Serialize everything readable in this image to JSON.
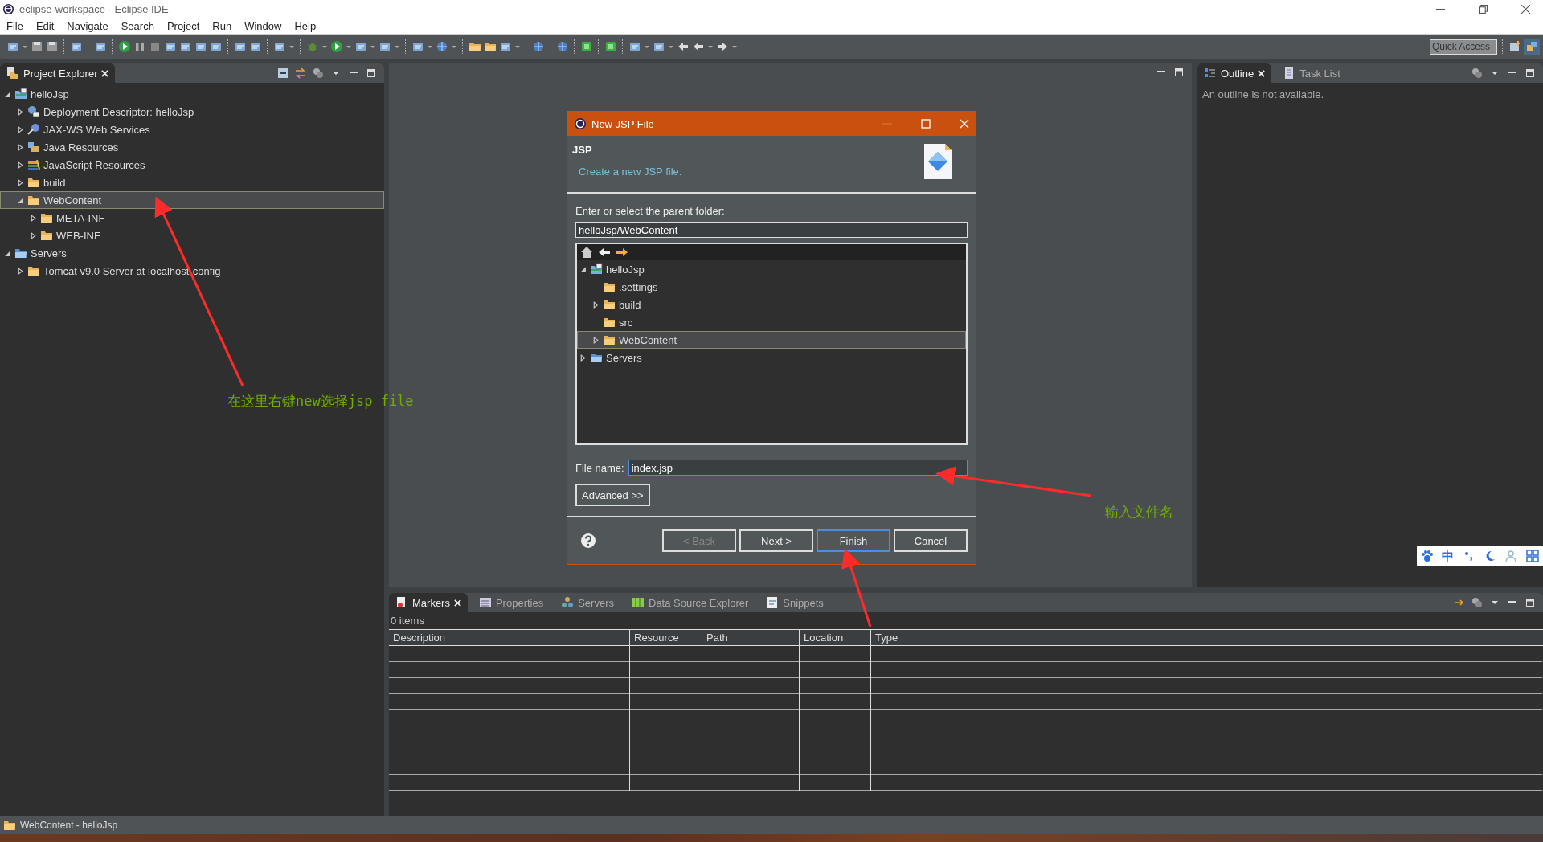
{
  "window": {
    "title": "eclipse-workspace - Eclipse IDE"
  },
  "menu": [
    "File",
    "Edit",
    "Navigate",
    "Search",
    "Project",
    "Run",
    "Window",
    "Help"
  ],
  "quick_access": {
    "placeholder": "Quick Access"
  },
  "project_explorer": {
    "tab": "Project Explorer",
    "tree": [
      {
        "label": "helloJsp",
        "kind": "project",
        "expanded": true,
        "selected": false,
        "children": [
          {
            "label": "Deployment Descriptor: helloJsp",
            "kind": "descriptor",
            "expanded": false,
            "selected": false
          },
          {
            "label": "JAX-WS Web Services",
            "kind": "webservice",
            "expanded": false,
            "selected": false
          },
          {
            "label": "Java Resources",
            "kind": "java",
            "expanded": false,
            "selected": false
          },
          {
            "label": "JavaScript Resources",
            "kind": "javascript",
            "expanded": false,
            "selected": false
          },
          {
            "label": "build",
            "kind": "folder",
            "expanded": false,
            "selected": false
          },
          {
            "label": "WebContent",
            "kind": "folder",
            "expanded": true,
            "selected": true,
            "children": [
              {
                "label": "META-INF",
                "kind": "folder",
                "expanded": false,
                "selected": false
              },
              {
                "label": "WEB-INF",
                "kind": "folder",
                "expanded": false,
                "selected": false
              }
            ]
          }
        ]
      },
      {
        "label": "Servers",
        "kind": "servers",
        "expanded": true,
        "selected": false,
        "children": [
          {
            "label": "Tomcat v9.0 Server at localhost-config",
            "kind": "folder",
            "expanded": false,
            "selected": false
          }
        ]
      }
    ]
  },
  "outline": {
    "tabs": [
      {
        "label": "Outline",
        "selected": true
      },
      {
        "label": "Task List",
        "selected": false
      }
    ],
    "message": "An outline is not available."
  },
  "dialog": {
    "title": "New JSP File",
    "heading": "JSP",
    "description": "Create a new JSP file.",
    "folder_label": "Enter or select the parent folder:",
    "folder_value": "helloJsp/WebContent",
    "tree": [
      {
        "label": "helloJsp",
        "kind": "project",
        "expanded": true,
        "selected": false,
        "children": [
          {
            "label": ".settings",
            "kind": "folder",
            "selected": false
          },
          {
            "label": "build",
            "kind": "folder",
            "expanded": false,
            "selected": false
          },
          {
            "label": "src",
            "kind": "folder",
            "selected": false
          },
          {
            "label": "WebContent",
            "kind": "folder",
            "expanded": false,
            "selected": true
          }
        ]
      },
      {
        "label": "Servers",
        "kind": "servers",
        "expanded": false,
        "selected": false
      }
    ],
    "file_name_label": "File name:",
    "file_name_value": "index.jsp",
    "advanced": "Advanced >>",
    "buttons": [
      {
        "label": "< Back",
        "disabled": true,
        "default": false
      },
      {
        "label": "Next >",
        "disabled": false,
        "default": false
      },
      {
        "label": "Finish",
        "disabled": false,
        "default": true
      },
      {
        "label": "Cancel",
        "disabled": false,
        "default": false
      }
    ]
  },
  "bottom_panel": {
    "tabs": [
      {
        "label": "Markers",
        "kind": "markers",
        "selected": true
      },
      {
        "label": "Properties",
        "kind": "properties",
        "selected": false
      },
      {
        "label": "Servers",
        "kind": "servers",
        "selected": false
      },
      {
        "label": "Data Source Explorer",
        "kind": "datasource",
        "selected": false
      },
      {
        "label": "Snippets",
        "kind": "snippets",
        "selected": false
      }
    ],
    "count": "0 items",
    "columns": [
      "Description",
      "Resource",
      "Path",
      "Location",
      "Type"
    ]
  },
  "status_bar": {
    "text": "WebContent - helloJsp"
  },
  "ime_bar": {
    "label": "中"
  },
  "annotations": [
    {
      "text": "在这里右键new选择jsp file"
    },
    {
      "text": "输入文件名"
    }
  ]
}
